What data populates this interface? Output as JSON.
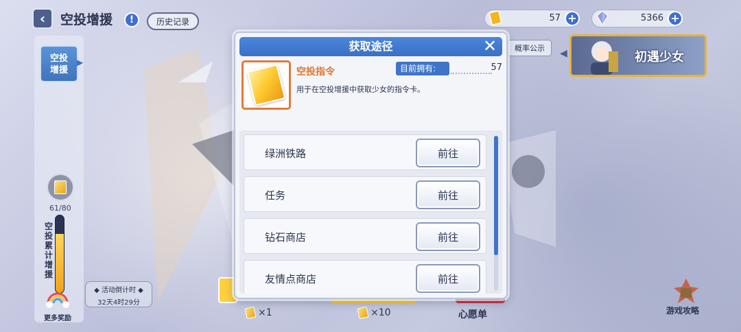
{
  "header": {
    "back_icon": "chevron-left-icon",
    "title": "空投增援",
    "info_icon": "info-icon",
    "history_label": "历史记录"
  },
  "currency": {
    "items": [
      {
        "icon": "command-card-icon",
        "value": "57"
      },
      {
        "icon": "diamond-icon",
        "value": "5366"
      }
    ]
  },
  "rate_label": "概率公示",
  "pool_banner": {
    "text": "初遇少女"
  },
  "left_panel": {
    "tab_label": "空投增援",
    "progress_text": "61/80",
    "progress_fraction": 0.7625,
    "bar_label": "空投累计增援",
    "more_reward_label": "更多奖励",
    "countdown_label": "◆ 活动倒计时 ◆",
    "countdown_value": "32天4时29分"
  },
  "bottom": {
    "draw_one_label": "×1",
    "draw_ten_label": "×10",
    "wishlist_label": "心愿单"
  },
  "guide_label": "游戏攻略",
  "modal": {
    "title": "获取途径",
    "close_icon": "close-icon",
    "item": {
      "name": "空投指令",
      "owned_label": "目前拥有:",
      "owned_value": "57",
      "description": "用于在空投增援中获取少女的指令卡。"
    },
    "sources": [
      {
        "name": "绿洲铁路",
        "button": "前往"
      },
      {
        "name": "任务",
        "button": "前往"
      },
      {
        "name": "钻石商店",
        "button": "前往"
      },
      {
        "name": "友情点商店",
        "button": "前往"
      }
    ]
  },
  "colors": {
    "accent_blue": "#3f74c9",
    "item_orange": "#e0752f",
    "gold": "#ffcf3e"
  }
}
